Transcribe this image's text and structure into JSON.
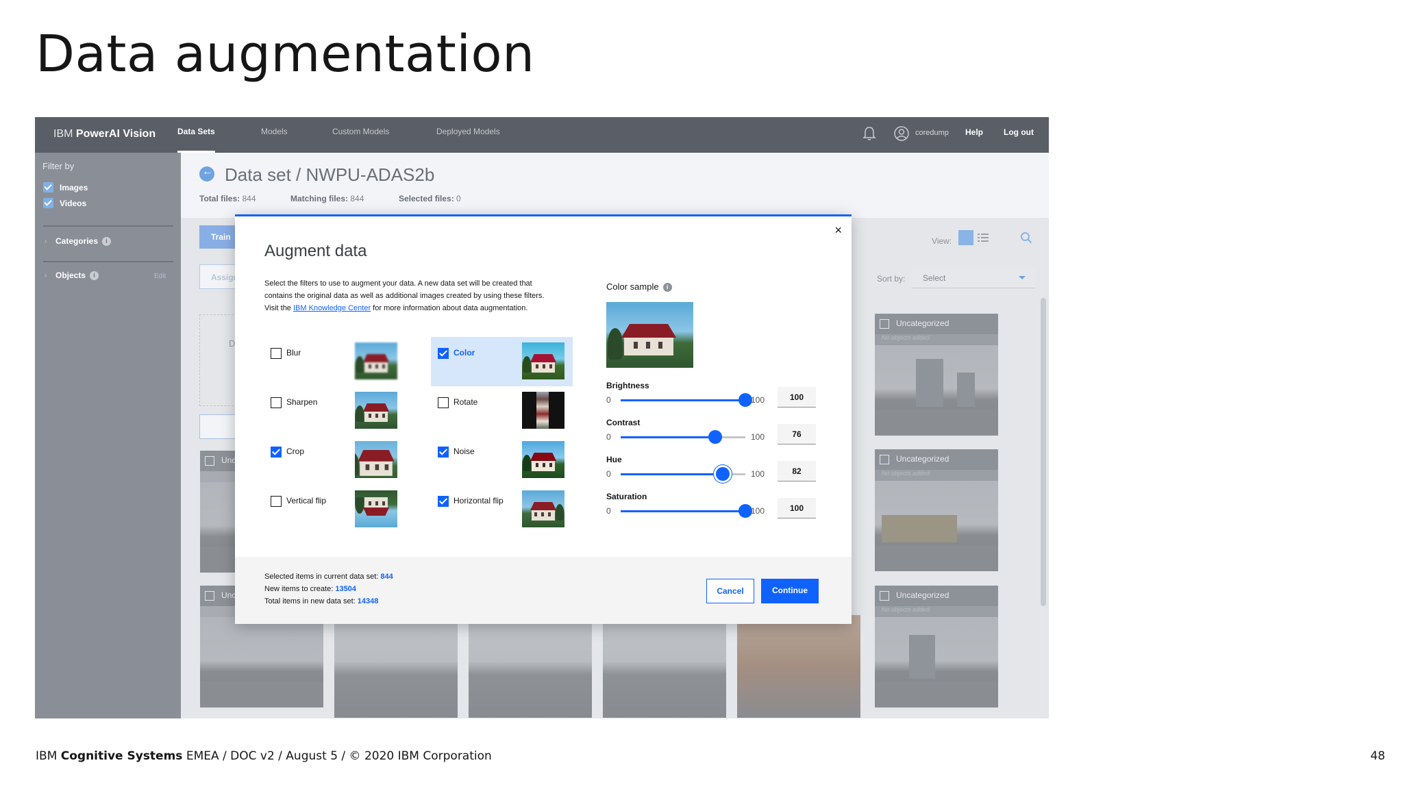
{
  "slide": {
    "title": "Data augmentation",
    "footer_brand": "IBM",
    "footer_bold": "Cognitive Systems",
    "footer_rest": "EMEA / DOC v2 / August 5 / © 2020 IBM Corporation",
    "page_number": "48"
  },
  "app": {
    "brand_prefix": "IBM",
    "brand_name": "PowerAI Vision",
    "nav": [
      "Data Sets",
      "Models",
      "Custom Models",
      "Deployed Models"
    ],
    "active_nav": "Data Sets",
    "user": "coredump",
    "help": "Help",
    "logout": "Log out",
    "icons": [
      "bell-icon",
      "user-icon",
      "grid-view-icon",
      "list-view-icon",
      "search-icon",
      "back-arrow-icon",
      "info-icon",
      "close-icon"
    ]
  },
  "sidebar": {
    "filter_by": "Filter by",
    "filters": [
      {
        "label": "Images",
        "checked": true
      },
      {
        "label": "Videos",
        "checked": true
      }
    ],
    "categories": "Categories",
    "objects": "Objects",
    "edit": "Edit"
  },
  "header": {
    "title": "Data set / NWPU-ADAS2b",
    "total_files_label": "Total files:",
    "total_files": "844",
    "matching_files_label": "Matching files:",
    "matching_files": "844",
    "selected_files_label": "Selected files:",
    "selected_files": "0"
  },
  "toolbar": {
    "train": "Train",
    "assign": "Assign",
    "dashed_text": "D",
    "view_label": "View:",
    "sort_label": "Sort by:",
    "sort_value": "Select"
  },
  "tiles": {
    "category": "Uncategorized",
    "sub": "No objects added",
    "partial_label": "Unc"
  },
  "modal": {
    "title": "Augment data",
    "desc_1": "Select the filters to use to augment your data. A new data set will be created that contains the original data as well as additional images created by using these filters. Visit the ",
    "desc_link": "IBM Knowledge Center",
    "desc_2": " for more information about data augmentation.",
    "filters": [
      {
        "label": "Blur",
        "checked": false
      },
      {
        "label": "Color",
        "checked": true
      },
      {
        "label": "Sharpen",
        "checked": false
      },
      {
        "label": "Rotate",
        "checked": false
      },
      {
        "label": "Crop",
        "checked": true
      },
      {
        "label": "Noise",
        "checked": true
      },
      {
        "label": "Vertical flip",
        "checked": false
      },
      {
        "label": "Horizontal flip",
        "checked": true
      }
    ],
    "color_sample": "Color sample",
    "sliders": [
      {
        "label": "Brightness",
        "min": "0",
        "max": "100",
        "value": 100
      },
      {
        "label": "Contrast",
        "min": "0",
        "max": "100",
        "value": 76
      },
      {
        "label": "Hue",
        "min": "0",
        "max": "100",
        "value": 82
      },
      {
        "label": "Saturation",
        "min": "0",
        "max": "100",
        "value": 100
      }
    ],
    "slider_values": [
      "100",
      "76",
      "82",
      "100"
    ],
    "summary": {
      "selected_label": "Selected items in current data set: ",
      "selected_value": "844",
      "new_label": "New items to create: ",
      "new_value": "13504",
      "total_label": "Total items in new data set: ",
      "total_value": "14348"
    },
    "cancel": "Cancel",
    "continue": "Continue",
    "close": "×"
  },
  "colors": {
    "primary": "#0f62fe",
    "topbar": "#5a5e66",
    "sidebar": "#8a8f97"
  }
}
